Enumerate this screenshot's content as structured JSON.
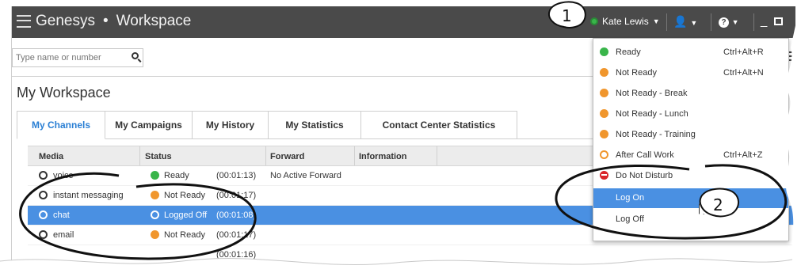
{
  "app": {
    "brand": "Genesys",
    "separator": "•",
    "product": "Workspace"
  },
  "titlebar": {
    "user_name": "Kate Lewis",
    "status_color": "#39b54a",
    "agent_icon": "agent-icon",
    "help_icon": "help-icon",
    "minimize_icon": "minimize-icon",
    "maximize_icon": "maximize-icon"
  },
  "search": {
    "placeholder": "Type name or number"
  },
  "workspace": {
    "title": "My Workspace",
    "tabs": [
      {
        "label": "My Channels",
        "active": true
      },
      {
        "label": "My Campaigns"
      },
      {
        "label": "My History"
      },
      {
        "label": "My Statistics"
      },
      {
        "label": "Contact Center Statistics"
      }
    ]
  },
  "table": {
    "columns": [
      "Media",
      "Status",
      "Forward",
      "Information"
    ],
    "rows": [
      {
        "media": "voice",
        "status": "Ready",
        "duration": "(00:01:13)",
        "forward": "No Active Forward",
        "status_kind": "ready"
      },
      {
        "media": "instant messaging",
        "status": "Not Ready",
        "duration": "(00:01:17)",
        "forward": "",
        "status_kind": "notready"
      },
      {
        "media": "chat",
        "status": "Logged Off",
        "duration": "(00:01:08)",
        "forward": "",
        "status_kind": "off",
        "selected": true
      },
      {
        "media": "email",
        "status": "Not Ready",
        "duration": "(00:01:17)",
        "forward": "",
        "status_kind": "notready"
      },
      {
        "media": "",
        "status": "",
        "duration": "(00:01:16)",
        "forward": "",
        "status_kind": "none"
      }
    ]
  },
  "status_menu": {
    "items": [
      {
        "label": "Ready",
        "shortcut": "Ctrl+Alt+R",
        "icon": "ready-icon"
      },
      {
        "label": "Not Ready",
        "shortcut": "Ctrl+Alt+N",
        "icon": "not-ready-icon"
      },
      {
        "label": "Not Ready - Break",
        "shortcut": "",
        "icon": "not-ready-icon"
      },
      {
        "label": "Not Ready - Lunch",
        "shortcut": "",
        "icon": "not-ready-icon"
      },
      {
        "label": "Not Ready - Training",
        "shortcut": "",
        "icon": "not-ready-icon"
      },
      {
        "label": "After Call Work",
        "shortcut": "Ctrl+Alt+Z",
        "icon": "after-call-work-icon"
      },
      {
        "label": "Do Not Disturb",
        "shortcut": "",
        "icon": "do-not-disturb-icon"
      },
      {
        "label": "Log On",
        "shortcut": "",
        "icon": "",
        "highlighted": true
      },
      {
        "label": "Log Off",
        "shortcut": "",
        "icon": ""
      }
    ]
  },
  "annotations": {
    "callout_1": "1",
    "callout_2": "2"
  },
  "colors": {
    "titlebar": "#4a4a4a",
    "accent": "#4a90e2",
    "ready": "#39b54a",
    "not_ready": "#f0962d",
    "dnd": "#d9252a",
    "tab_active": "#2a7fd4"
  }
}
